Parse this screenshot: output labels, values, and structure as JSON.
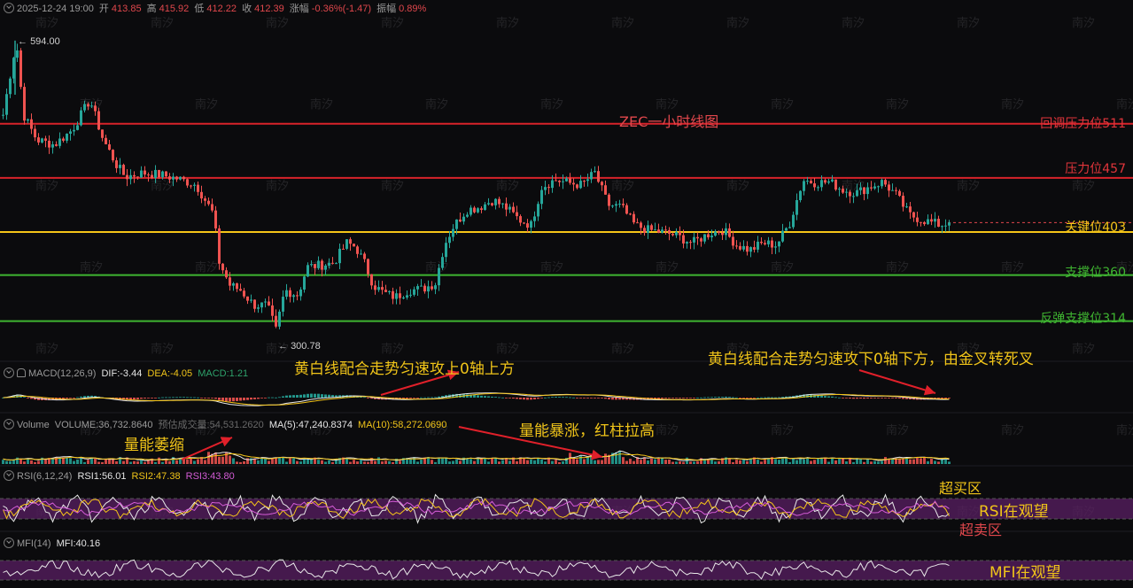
{
  "header": {
    "datetime": "2025-12-24 19:00",
    "open_label": "开",
    "open": "413.85",
    "high_label": "高",
    "high": "415.92",
    "low_label": "低",
    "low": "412.22",
    "close_label": "收",
    "close": "412.39",
    "change_label": "涨幅",
    "change": "-0.36%(-1.47)",
    "amplitude_label": "振幅",
    "amplitude": "0.89%"
  },
  "macd_header": {
    "name": "MACD(12,26,9)",
    "dif": "DIF:-3.44",
    "dea": "DEA:-4.05",
    "macd": "MACD:1.21"
  },
  "volume_header": {
    "name": "Volume",
    "volume": "VOLUME:36,732.8640",
    "est": "预估成交量:54,531.2620",
    "ma5": "MA(5):47,240.8374",
    "ma10": "MA(10):58,272.0690"
  },
  "rsi_header": {
    "name": "RSI(6,12,24)",
    "rsi1": "RSI1:56.01",
    "rsi2": "RSI2:47.38",
    "rsi3": "RSI3:43.80"
  },
  "mfi_header": {
    "name": "MFI(14)",
    "mfi": "MFI:40.16"
  },
  "annotations": {
    "title": "ZEC一小时线图",
    "macd_up": "黄白线配合走势匀速攻上0轴上方",
    "macd_down": "黄白线配合走势匀速攻下0轴下方，由金叉转死叉",
    "vol_shrink": "量能萎缩",
    "vol_surge": "量能暴涨，红柱拉高",
    "overbought": "超买区",
    "rsi_watch": "RSI在观望",
    "oversold": "超卖区",
    "mfi_watch": "MFI在观望"
  },
  "watermark": "南汐",
  "colors": {
    "up": "#26a69a",
    "down": "#ef5350",
    "red_line": "#d8232a",
    "yellow_line": "#f5c518",
    "green_line": "#3fb531",
    "band": "#5a1f63"
  },
  "chart_data": {
    "type": "candlestick",
    "title": "ZEC一小时线图",
    "y_range": [
      280,
      620
    ],
    "max_label": "594.00",
    "min_label": "300.78",
    "levels": [
      {
        "label": "回调压力位511",
        "value": 511,
        "color": "#d8232a"
      },
      {
        "label": "压力位457",
        "value": 457,
        "color": "#d8232a"
      },
      {
        "label": "关键位403",
        "value": 403,
        "color": "#f5c518"
      },
      {
        "label": "支撑位360",
        "value": 360,
        "color": "#3fb531"
      },
      {
        "label": "反弹支撑位314",
        "value": 314,
        "color": "#3fb531"
      }
    ],
    "last_close": 412.39,
    "price_path": [
      [
        0,
        510
      ],
      [
        10,
        560
      ],
      [
        17,
        594
      ],
      [
        25,
        520
      ],
      [
        40,
        495
      ],
      [
        60,
        490
      ],
      [
        80,
        505
      ],
      [
        100,
        535
      ],
      [
        115,
        495
      ],
      [
        130,
        470
      ],
      [
        140,
        458
      ],
      [
        160,
        462
      ],
      [
        180,
        460
      ],
      [
        200,
        456
      ],
      [
        220,
        450
      ],
      [
        240,
        420
      ],
      [
        245,
        375
      ],
      [
        258,
        350
      ],
      [
        270,
        345
      ],
      [
        285,
        330
      ],
      [
        300,
        330
      ],
      [
        310,
        305
      ],
      [
        320,
        345
      ],
      [
        335,
        340
      ],
      [
        345,
        368
      ],
      [
        360,
        370
      ],
      [
        375,
        372
      ],
      [
        390,
        392
      ],
      [
        400,
        388
      ],
      [
        410,
        372
      ],
      [
        420,
        350
      ],
      [
        432,
        342
      ],
      [
        445,
        338
      ],
      [
        460,
        345
      ],
      [
        475,
        346
      ],
      [
        490,
        352
      ],
      [
        500,
        390
      ],
      [
        510,
        408
      ],
      [
        525,
        425
      ],
      [
        540,
        428
      ],
      [
        555,
        435
      ],
      [
        570,
        427
      ],
      [
        585,
        415
      ],
      [
        598,
        410
      ],
      [
        610,
        448
      ],
      [
        625,
        455
      ],
      [
        640,
        452
      ],
      [
        655,
        450
      ],
      [
        670,
        462
      ],
      [
        685,
        430
      ],
      [
        700,
        428
      ],
      [
        715,
        410
      ],
      [
        730,
        405
      ],
      [
        745,
        403
      ],
      [
        760,
        400
      ],
      [
        780,
        392
      ],
      [
        800,
        402
      ],
      [
        815,
        405
      ],
      [
        830,
        390
      ],
      [
        845,
        385
      ],
      [
        860,
        392
      ],
      [
        875,
        390
      ],
      [
        890,
        412
      ],
      [
        905,
        455
      ],
      [
        920,
        452
      ],
      [
        935,
        453
      ],
      [
        950,
        445
      ],
      [
        965,
        442
      ],
      [
        980,
        448
      ],
      [
        995,
        453
      ],
      [
        1010,
        440
      ],
      [
        1025,
        420
      ],
      [
        1040,
        415
      ],
      [
        1060,
        410
      ],
      [
        1070,
        412
      ]
    ],
    "indicators": {
      "macd": {
        "dif": -3.44,
        "dea": -4.05,
        "hist": 1.21
      },
      "volume": {
        "volume": 36732.864,
        "ma5": 47240.8374,
        "ma10": 58272.069
      },
      "rsi": {
        "rsi1": 56.01,
        "rsi2": 47.38,
        "rsi3": 43.8,
        "band": [
          30,
          70
        ]
      },
      "mfi": {
        "mfi": 40.16,
        "band": [
          20,
          80
        ]
      }
    }
  }
}
